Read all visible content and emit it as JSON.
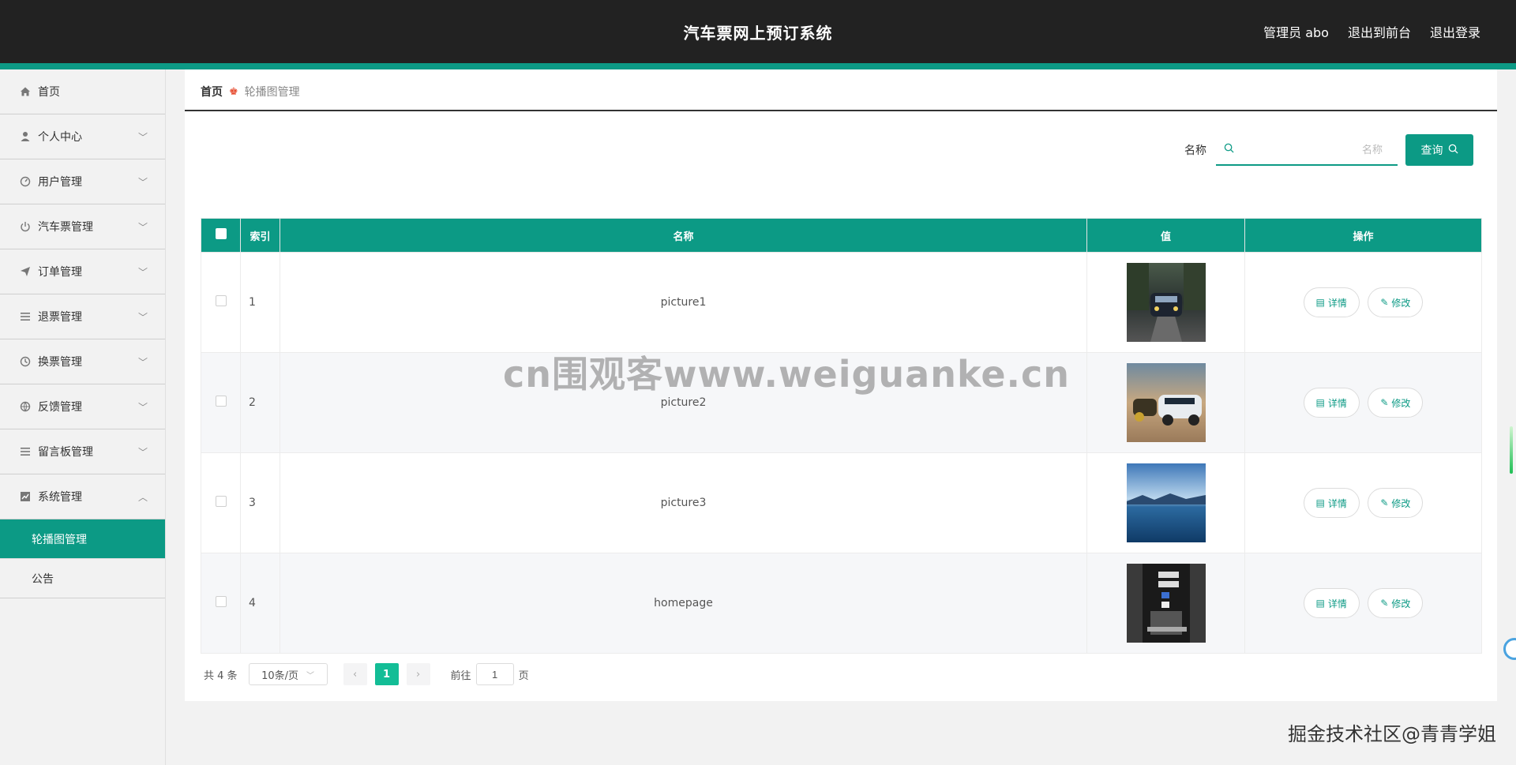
{
  "header": {
    "title": "汽车票网上预订系统",
    "links": [
      "管理员 abo",
      "退出到前台",
      "退出登录"
    ]
  },
  "sidebar": {
    "items": [
      {
        "label": "首页",
        "icon": "home-icon",
        "expandable": false
      },
      {
        "label": "个人中心",
        "icon": "user-icon",
        "expandable": true
      },
      {
        "label": "用户管理",
        "icon": "gauge-icon",
        "expandable": true
      },
      {
        "label": "汽车票管理",
        "icon": "power-icon",
        "expandable": true
      },
      {
        "label": "订单管理",
        "icon": "send-icon",
        "expandable": true
      },
      {
        "label": "退票管理",
        "icon": "list-icon",
        "expandable": true
      },
      {
        "label": "换票管理",
        "icon": "clock-icon",
        "expandable": true
      },
      {
        "label": "反馈管理",
        "icon": "globe-icon",
        "expandable": true
      },
      {
        "label": "留言板管理",
        "icon": "list-icon",
        "expandable": true
      },
      {
        "label": "系统管理",
        "icon": "chart-icon",
        "expandable": true,
        "expanded": true
      }
    ],
    "subitems": [
      {
        "label": "轮播图管理",
        "active": true
      },
      {
        "label": "公告",
        "active": false
      }
    ]
  },
  "breadcrumb": {
    "home": "首页",
    "current": "轮播图管理"
  },
  "search": {
    "label": "名称",
    "placeholder": "名称",
    "value": "",
    "button": "查询"
  },
  "table": {
    "columns": [
      "索引",
      "名称",
      "值",
      "操作"
    ],
    "rows": [
      {
        "index": "1",
        "name": "picture1",
        "thumb": "thumb-car-road"
      },
      {
        "index": "2",
        "name": "picture2",
        "thumb": "thumb-cars-desert"
      },
      {
        "index": "3",
        "name": "picture3",
        "thumb": "thumb-lake"
      },
      {
        "index": "4",
        "name": "homepage",
        "thumb": "thumb-poster"
      }
    ],
    "actions": {
      "detail": "详情",
      "edit": "修改"
    }
  },
  "pagination": {
    "total": "共 4 条",
    "page_size": "10条/页",
    "current_page": "1",
    "goto_label": "前往",
    "goto_value": "1",
    "goto_suffix": "页"
  },
  "overlay": {
    "watermark": "cn围观客www.weiguanke.cn",
    "footer": "掘金技术社区@青青学姐"
  },
  "colors": {
    "accent": "#0c9a85",
    "header_bg": "#222222",
    "page_active": "#13bd96"
  }
}
